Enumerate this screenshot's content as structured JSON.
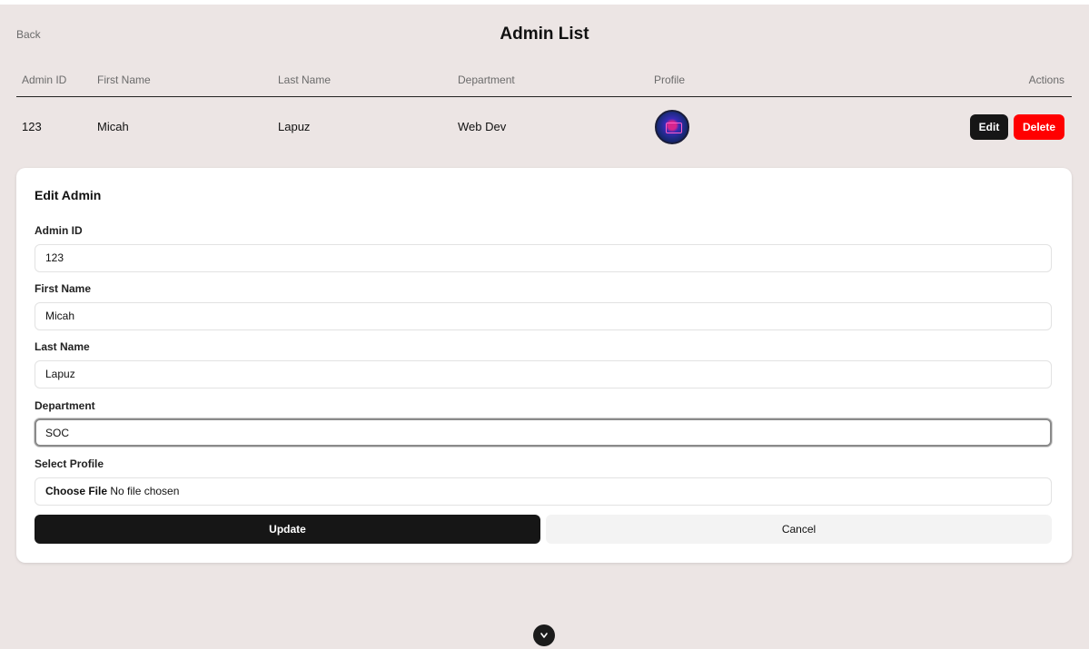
{
  "header": {
    "back_label": "Back",
    "title": "Admin List"
  },
  "table": {
    "columns": [
      "Admin ID",
      "First Name",
      "Last Name",
      "Department",
      "Profile",
      "Actions"
    ],
    "rows": [
      {
        "admin_id": "123",
        "first_name": "Micah",
        "last_name": "Lapuz",
        "department": "Web Dev",
        "edit_label": "Edit",
        "delete_label": "Delete"
      }
    ]
  },
  "edit_form": {
    "title": "Edit Admin",
    "fields": [
      {
        "label": "Admin ID",
        "value": "123"
      },
      {
        "label": "First Name",
        "value": "Micah"
      },
      {
        "label": "Last Name",
        "value": "Lapuz"
      },
      {
        "label": "Department",
        "value": "SOC"
      }
    ],
    "profile": {
      "label": "Select Profile",
      "button_label": "Choose File",
      "status": "No file chosen"
    },
    "update_label": "Update",
    "cancel_label": "Cancel"
  },
  "scroll_icon": "chevron-down-icon",
  "colors": {
    "background": "#ece5e4",
    "primary": "#161616",
    "danger": "#ff0000"
  }
}
